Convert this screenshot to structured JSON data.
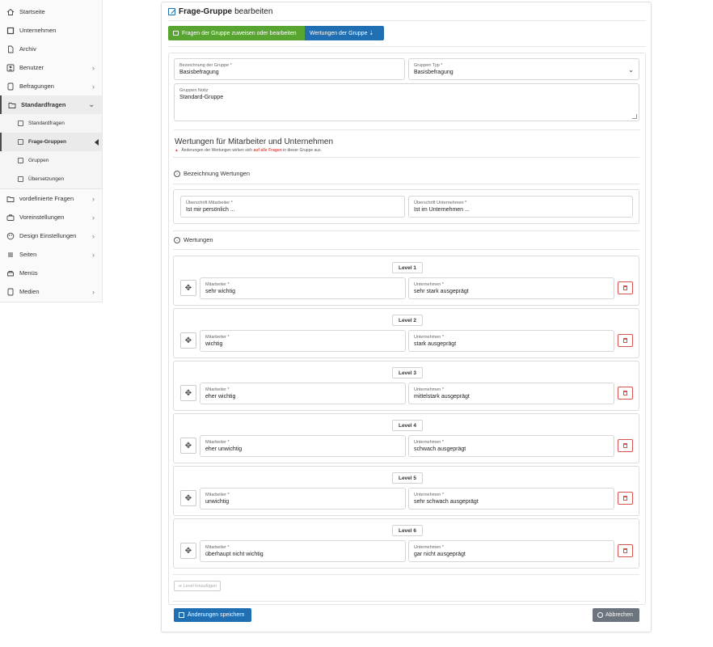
{
  "sidebar": {
    "items": [
      {
        "label": "Startseite",
        "icon": "home-icon",
        "chevron": ""
      },
      {
        "label": "Unternehmen",
        "icon": "building-icon",
        "chevron": ""
      },
      {
        "label": "Archiv",
        "icon": "file-icon",
        "chevron": ""
      },
      {
        "label": "Benutzer",
        "icon": "user-icon",
        "chevron": "›"
      },
      {
        "label": "Befragungen",
        "icon": "document-icon",
        "chevron": "›"
      },
      {
        "label": "Standardfragen",
        "icon": "folder-icon",
        "chevron": "⌄"
      }
    ],
    "subitems": [
      {
        "label": "Standardfragen",
        "icon": "list-icon"
      },
      {
        "label": "Frage-Gruppen",
        "icon": "grid-icon"
      },
      {
        "label": "Gruppen",
        "icon": "box-icon"
      },
      {
        "label": "Übersetzungen",
        "icon": "folder-icon"
      }
    ],
    "items2": [
      {
        "label": "vordefinierte Fragen",
        "icon": "folder-icon",
        "chevron": "›"
      },
      {
        "label": "Voreinstellungen",
        "icon": "briefcase-icon",
        "chevron": "›"
      },
      {
        "label": "Design Einstellungen",
        "icon": "palette-icon",
        "chevron": "›"
      },
      {
        "label": "Seiten",
        "icon": "lines-icon",
        "chevron": "›"
      },
      {
        "label": "Menüs",
        "icon": "menu-icon",
        "chevron": ""
      },
      {
        "label": "Medien",
        "icon": "media-icon",
        "chevron": "›"
      }
    ]
  },
  "header": {
    "title_bold": "Frage-Gruppe",
    "title_rest": "bearbeiten"
  },
  "tabs": {
    "assign": "Fragen der Gruppe zuweisen oder bearbeiten",
    "ratings": "Wertungen der Gruppe  ⇣"
  },
  "form": {
    "group_name_label": "Bezeichnung der Gruppe *",
    "group_name_value": "Basisbefragung",
    "group_type_label": "Gruppen Typ *",
    "group_type_value": "Basisbefragung",
    "note_label": "Gruppen Notiz",
    "note_value": "Standard-Gruppe"
  },
  "ratings": {
    "heading": "Wertungen für Mitarbeiter und Unternehmen",
    "warning_pre": "Änderungen der Wertungen wirken sich",
    "warning_bold": "auf alle Fragen",
    "warning_post": "in dieser Gruppe aus.",
    "section_labels": "Bezeichnung Wertungen",
    "emp_header_label": "Überschrift Mitarbeiter *",
    "emp_header_value": "Ist mir persönlich ...",
    "comp_header_label": "Überschrift Unternehmen *",
    "comp_header_value": "Ist im Unternehmen ...",
    "section_values": "Wertungen",
    "emp_label": "Mitarbeiter *",
    "comp_label": "Unternehmen *",
    "levels": [
      {
        "label": "Level 1",
        "employee": "sehr wichtig",
        "company": "sehr stark ausgeprägt"
      },
      {
        "label": "Level 2",
        "employee": "wichtig",
        "company": "stark ausgeprägt"
      },
      {
        "label": "Level 3",
        "employee": "eher wichtig",
        "company": "mittelstark ausgeprägt"
      },
      {
        "label": "Level 4",
        "employee": "eher unwichtig",
        "company": "schwach ausgeprägt"
      },
      {
        "label": "Level 5",
        "employee": "unwichtig",
        "company": "sehr schwach ausgeprägt"
      },
      {
        "label": "Level 6",
        "employee": "überhaupt nicht wichtig",
        "company": "gar nicht ausgeprägt"
      }
    ],
    "add_level": "Level hinzufügen"
  },
  "actions": {
    "save": "Änderungen speichern",
    "cancel": "Abbrechen"
  },
  "colors": {
    "primary": "#1f6fb2",
    "success": "#59a532",
    "danger": "#d9534f",
    "secondary": "#6c757d"
  }
}
